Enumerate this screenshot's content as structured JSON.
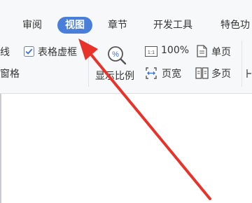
{
  "tabs": [
    {
      "label": "审阅",
      "active": false
    },
    {
      "label": "视图",
      "active": true
    },
    {
      "label": "章节",
      "active": false
    },
    {
      "label": "开发工具",
      "active": false
    },
    {
      "label": "特色功",
      "active": false
    }
  ],
  "ribbon": {
    "cut_left_top": "线",
    "cut_left_bottom": "窗格",
    "table_gridlines_checkbox": {
      "label": "表格虚框",
      "checked": true
    },
    "zoom_ratio_label": "显示比例",
    "zoom_percent_label": "100%",
    "page_width_label": "页宽",
    "single_page_label": "单页",
    "multi_page_label": "多页"
  },
  "colors": {
    "active_tab": "#4a7fd9",
    "arrow": "#e8332a",
    "ribbon_bg": "#f7f8fa"
  }
}
